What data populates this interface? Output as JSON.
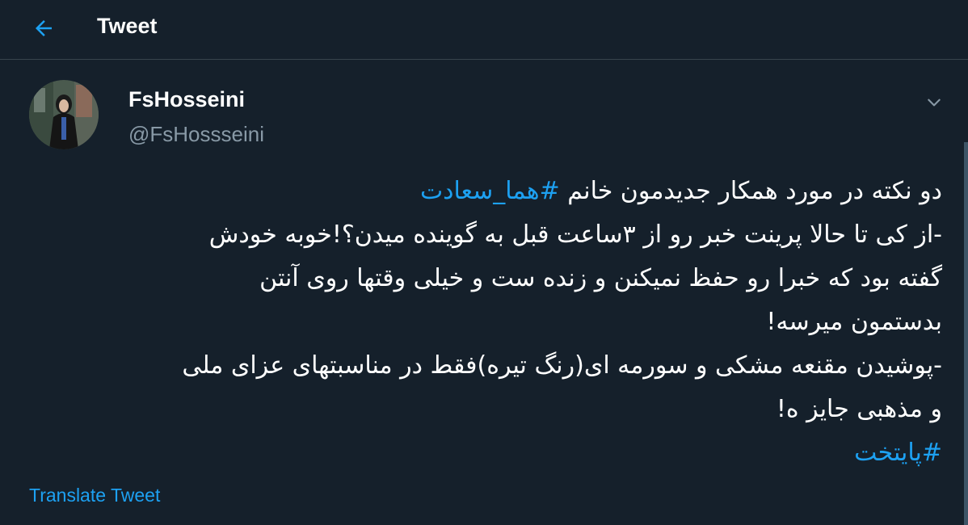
{
  "header": {
    "title": "Tweet",
    "back_icon": "arrow-left-icon"
  },
  "colors": {
    "background": "#15202b",
    "accent": "#1da1f2",
    "secondary_text": "#8899a6",
    "divider": "#38444d"
  },
  "tweet": {
    "author": {
      "display_name": "FsHosseini",
      "handle": "@FsHossseini"
    },
    "more_icon": "chevron-down-icon",
    "lines": [
      {
        "text": "دو نکته در مورد همکار جدیدمون خانم ",
        "hashtag": "#هما_سعادت"
      },
      {
        "text": "-از کی تا حالا پرینت خبر رو از ۳ساعت قبل به گوینده میدن؟!خوبه خودش"
      },
      {
        "text": "گفته بود که خبرا رو حفظ نمیکنن و زنده ست و خیلی وقتها روی آنتن"
      },
      {
        "text": "بدستمون میرسه!"
      },
      {
        "text": "-پوشیدن مقنعه مشکی و سورمه ای(رنگ تیره)فقط در مناسبتهای عزای ملی"
      },
      {
        "text": "و مذهبی جایز ه!"
      },
      {
        "text": "",
        "hashtag": "#پایتخت"
      }
    ],
    "translate_label": "Translate Tweet"
  }
}
